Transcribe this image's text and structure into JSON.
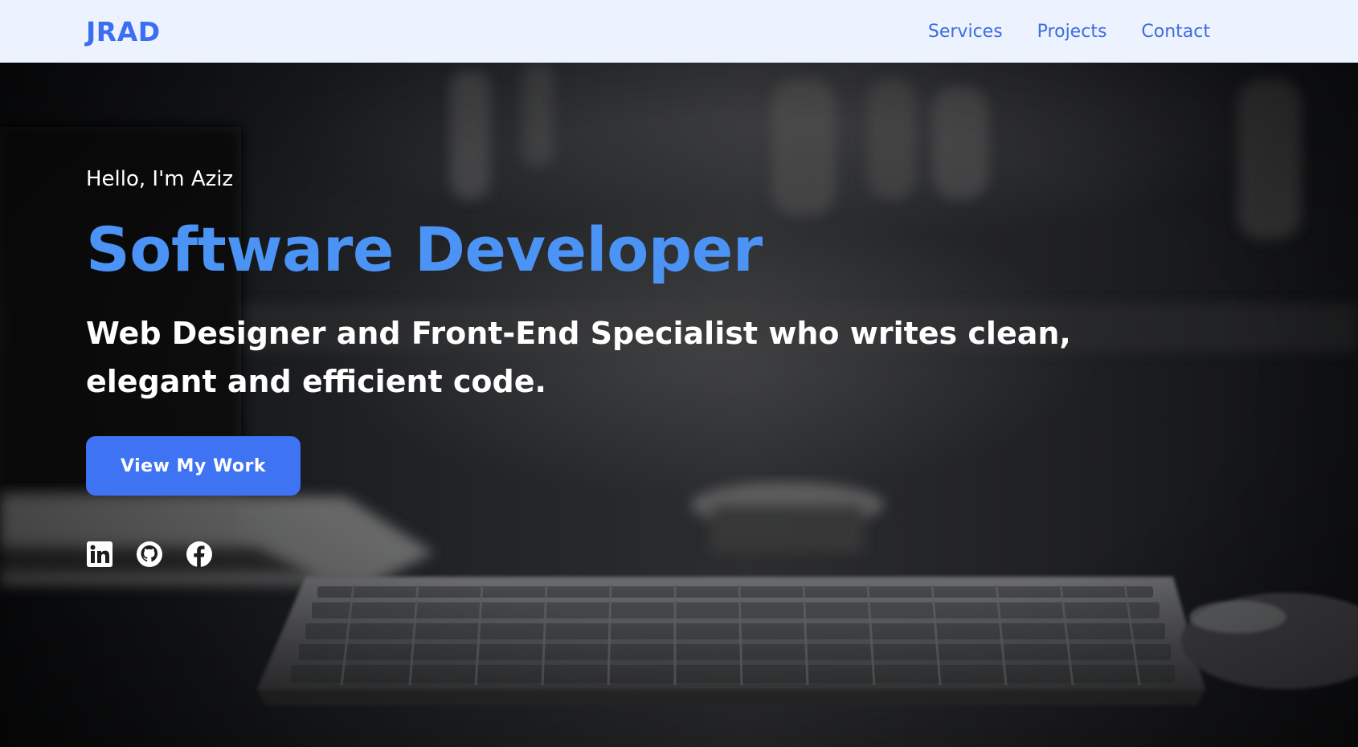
{
  "header": {
    "logo": "JRAD",
    "nav": [
      {
        "label": "Services"
      },
      {
        "label": "Projects"
      },
      {
        "label": "Contact"
      }
    ]
  },
  "hero": {
    "greeting": "Hello, I'm Aziz",
    "title": "Software Developer",
    "subtitle": "Web Designer and Front-End Specialist who writes clean, elegant and efficient code.",
    "cta_label": "View My Work",
    "socials": [
      {
        "icon": "linkedin-icon"
      },
      {
        "icon": "github-icon"
      },
      {
        "icon": "facebook-icon"
      }
    ]
  },
  "colors": {
    "brand": "#3b6ef2",
    "title": "#4b93f5",
    "button": "#3e73f3",
    "header_bg": "#edf2ff"
  }
}
